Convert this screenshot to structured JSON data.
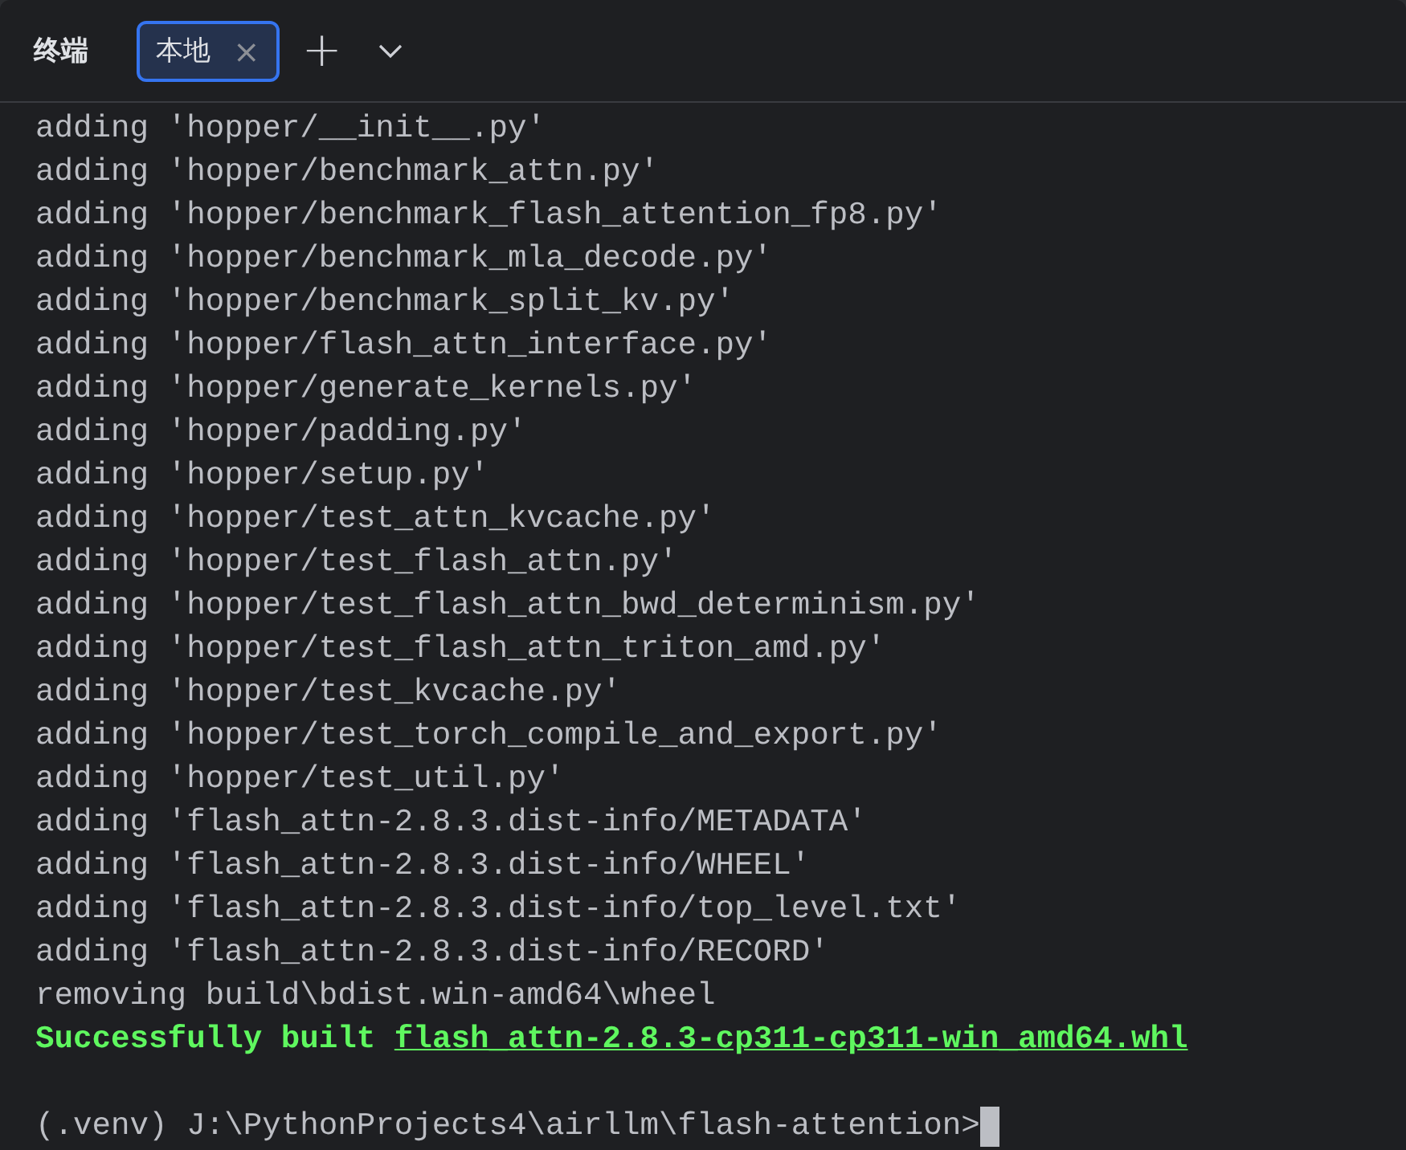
{
  "header": {
    "title": "终端",
    "tabs": [
      {
        "label": "本地",
        "selected": true,
        "close": "×"
      }
    ],
    "add": "+"
  },
  "lines": [
    {
      "kind": "plain",
      "text": "adding 'hopper/__init__.py'"
    },
    {
      "kind": "plain",
      "text": "adding 'hopper/benchmark_attn.py'"
    },
    {
      "kind": "plain",
      "text": "adding 'hopper/benchmark_flash_attention_fp8.py'"
    },
    {
      "kind": "plain",
      "text": "adding 'hopper/benchmark_mla_decode.py'"
    },
    {
      "kind": "plain",
      "text": "adding 'hopper/benchmark_split_kv.py'"
    },
    {
      "kind": "plain",
      "text": "adding 'hopper/flash_attn_interface.py'"
    },
    {
      "kind": "plain",
      "text": "adding 'hopper/generate_kernels.py'"
    },
    {
      "kind": "plain",
      "text": "adding 'hopper/padding.py'"
    },
    {
      "kind": "plain",
      "text": "adding 'hopper/setup.py'"
    },
    {
      "kind": "plain",
      "text": "adding 'hopper/test_attn_kvcache.py'"
    },
    {
      "kind": "plain",
      "text": "adding 'hopper/test_flash_attn.py'"
    },
    {
      "kind": "plain",
      "text": "adding 'hopper/test_flash_attn_bwd_determinism.py'"
    },
    {
      "kind": "plain",
      "text": "adding 'hopper/test_flash_attn_triton_amd.py'"
    },
    {
      "kind": "plain",
      "text": "adding 'hopper/test_kvcache.py'"
    },
    {
      "kind": "plain",
      "text": "adding 'hopper/test_torch_compile_and_export.py'"
    },
    {
      "kind": "plain",
      "text": "adding 'hopper/test_util.py'"
    },
    {
      "kind": "plain",
      "text": "adding 'flash_attn-2.8.3.dist-info/METADATA'"
    },
    {
      "kind": "plain",
      "text": "adding 'flash_attn-2.8.3.dist-info/WHEEL'"
    },
    {
      "kind": "plain",
      "text": "adding 'flash_attn-2.8.3.dist-info/top_level.txt'"
    },
    {
      "kind": "plain",
      "text": "adding 'flash_attn-2.8.3.dist-info/RECORD'"
    },
    {
      "kind": "plain",
      "text": "removing build\\bdist.win-amd64\\wheel"
    },
    {
      "kind": "success",
      "text": "Successfully built",
      "link": "flash_attn-2.8.3-cp311-cp311-win_amd64.whl"
    },
    {
      "kind": "blank"
    },
    {
      "kind": "prompt",
      "text": "(.venv) J:\\PythonProjects4\\airllm\\flash-attention>"
    }
  ]
}
